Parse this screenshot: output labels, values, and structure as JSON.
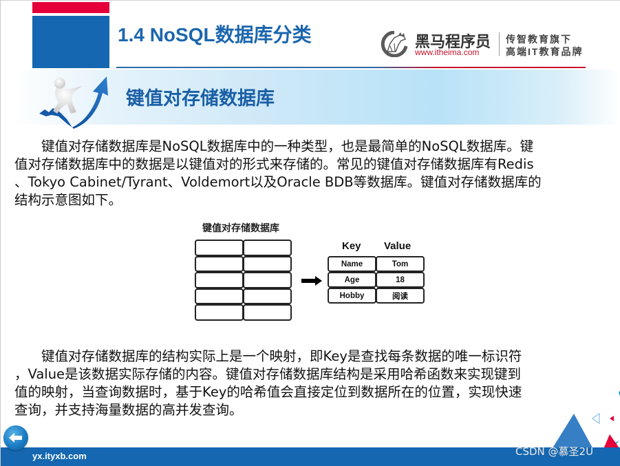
{
  "header": {
    "title": "1.4 NoSQL数据库分类",
    "accent_red": "#e5003a",
    "accent_blue": "#1467b0"
  },
  "logo": {
    "icon": "horse-head-logo-icon",
    "name": "黑马程序员",
    "url": "www.itheima.com",
    "tagline_1": "传智教育旗下",
    "tagline_2": "高端IT教育品牌"
  },
  "section": {
    "icon": "surfer-arrow-icon",
    "title": "键值对存储数据库"
  },
  "paragraph_1": {
    "lines": [
      "　　键值对存储数据库是NoSQL数据库中的一种类型，也是最简单的NoSQL数据库。键",
      "值对存储数据库中的数据是以键值对的形式来存储的。常见的键值对存储数据库有Redis",
      "、Tokyo Cabinet/Tyrant、Voldemort以及Oracle BDB等数据库。键值对存储数据库的",
      "结构示意图如下。"
    ]
  },
  "diagram": {
    "db_title": "键值对存储数据库",
    "db_rows": 5,
    "db_cols": 2,
    "arrow_icon": "right-arrow-icon",
    "kv_headers": [
      "Key",
      "Value"
    ],
    "kv_rows": [
      [
        "Name",
        "Tom"
      ],
      [
        "Age",
        "18"
      ],
      [
        "Hobby",
        "阅读"
      ]
    ]
  },
  "paragraph_2": {
    "lines": [
      "　　键值对存储数据库的结构实际上是一个映射，即Key是查找每条数据的唯一标识符",
      "，Value是该数据实际存储的内容。键值对存储数据库结构是采用哈希函数来实现键到",
      "值的映射，当查询数据时，基于Key的哈希值会直接定位到数据所在的位置，实现快速",
      "查询，并支持海量数据的高并发查询。"
    ]
  },
  "footer": {
    "back_icon": "back-arrow-icon",
    "url": "yx.ityxb.com",
    "watermark": "CSDN @慕圣2U"
  }
}
